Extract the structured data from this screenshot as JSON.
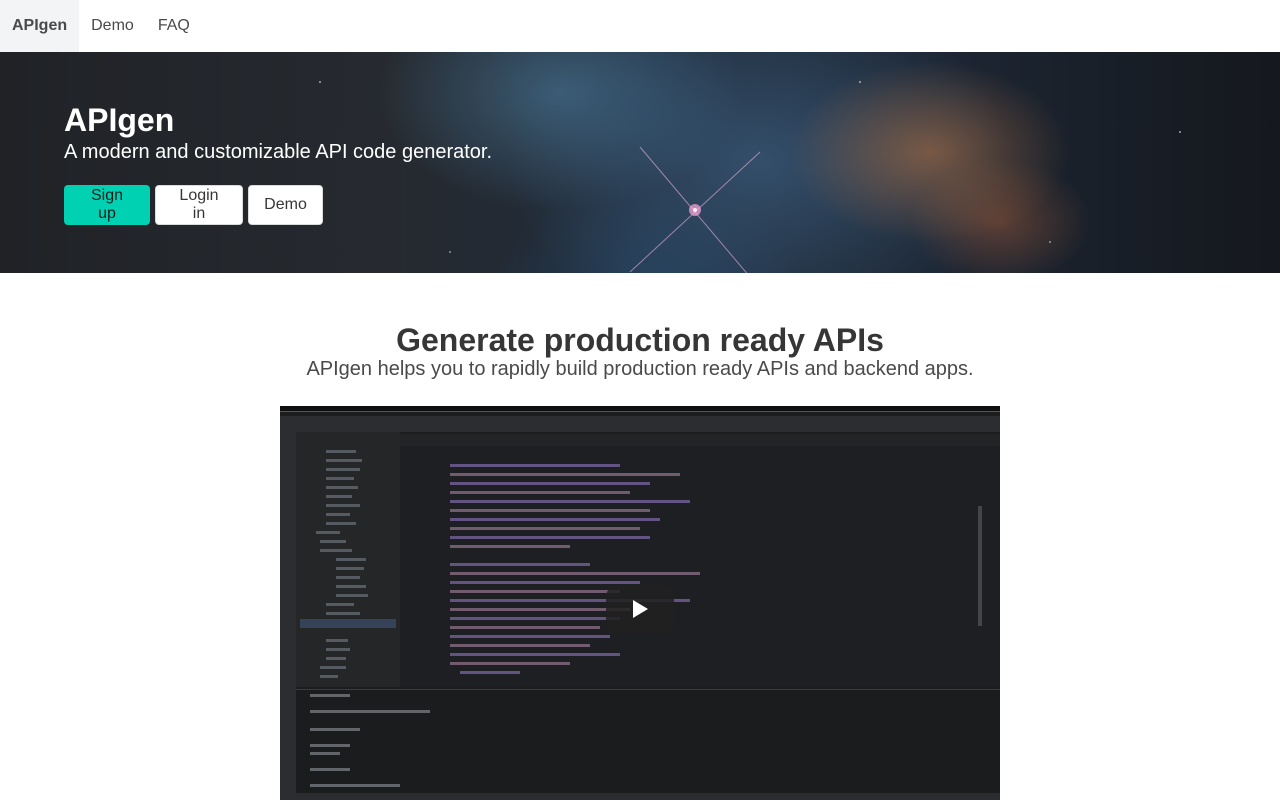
{
  "navbar": {
    "brand": "APIgen",
    "items": [
      {
        "label": "Demo"
      },
      {
        "label": "FAQ"
      }
    ]
  },
  "hero": {
    "title": "APIgen",
    "subtitle": "A modern and customizable API code generator.",
    "buttons": {
      "signup": "Sign up",
      "login": "Login in",
      "demo": "Demo"
    }
  },
  "main": {
    "title": "Generate production ready APIs",
    "subtitle": "APIgen helps you to rapidly build production ready APIs and backend apps."
  },
  "video": {
    "play_icon": "play-icon"
  },
  "colors": {
    "primary": "#00d1b2",
    "text": "#363636",
    "hero_bg": "#1f2b39"
  }
}
